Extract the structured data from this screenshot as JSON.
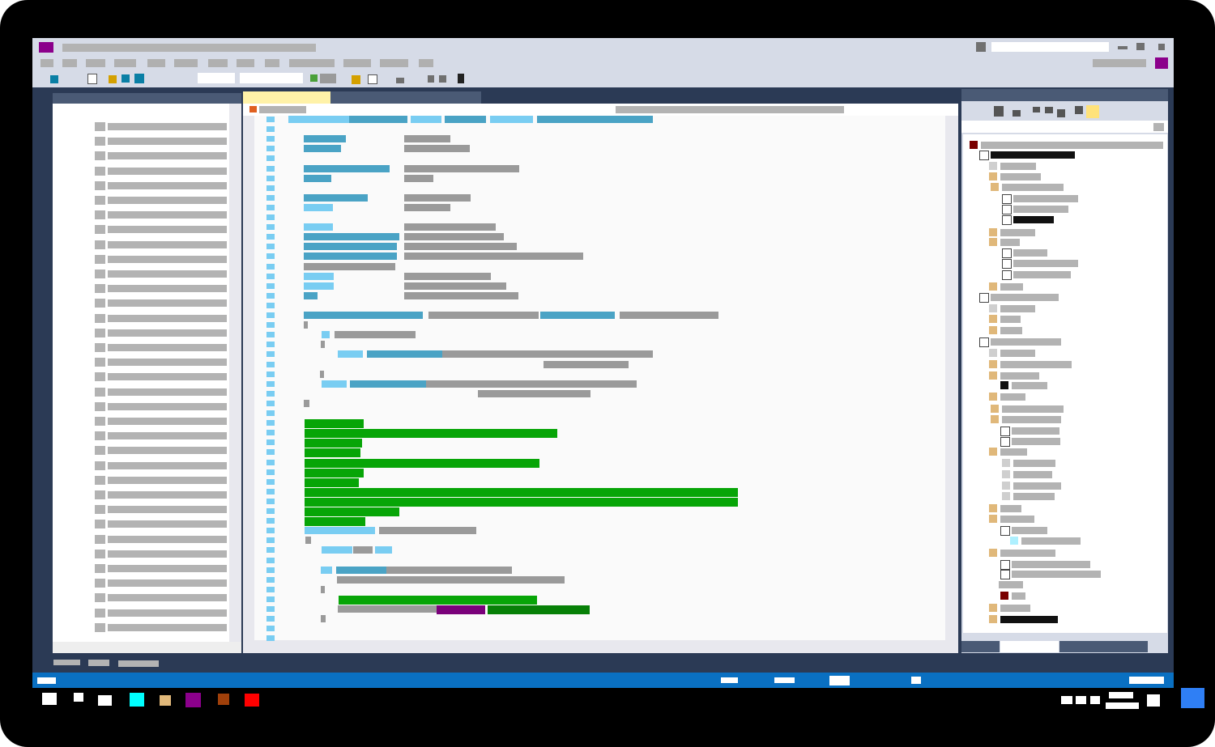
{
  "window": {
    "title": ""
  },
  "menu": {
    "items": [
      "",
      "",
      "",
      "",
      "",
      "",
      "",
      "",
      "",
      "",
      "",
      "",
      "",
      ""
    ]
  },
  "toolbar": {
    "search_placeholder": "",
    "combo_value": ""
  },
  "editor": {
    "active_tab": "",
    "inactive_tab": "",
    "path": ""
  },
  "colors": {
    "screen_bg": "#2b3a55",
    "chrome": "#d6dbe7",
    "accent_purple": "#8b008b",
    "status_blue": "#0a70c2",
    "code_blue": "#4aa3c5",
    "code_light_blue": "#79cdf2",
    "code_green": "#07a507",
    "tree_folder": "#e0b87a"
  },
  "icons": [
    "app-icon",
    "minimize-icon",
    "maximize-icon",
    "close-icon",
    "save-icon",
    "open-icon",
    "build-icon",
    "run-icon",
    "folder-icon",
    "file-icon",
    "checkbox-icon"
  ],
  "status": {
    "items": [
      "",
      "",
      "",
      "",
      "",
      ""
    ]
  },
  "taskbar": {
    "apps": [
      "",
      "",
      "",
      "",
      "",
      "",
      "",
      ""
    ]
  }
}
